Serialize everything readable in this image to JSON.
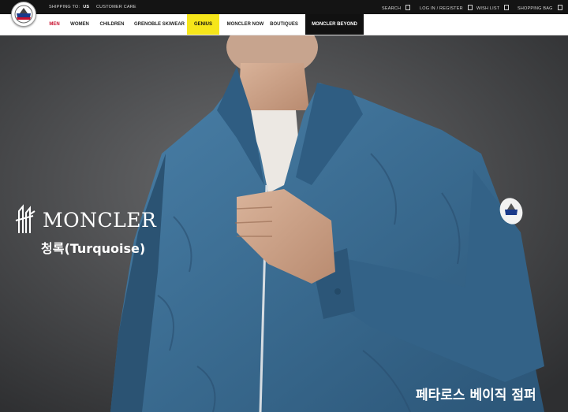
{
  "topbar": {
    "shipping_label": "SHIPPING TO:",
    "shipping_value": "US",
    "customer_care": "CUSTOMER CARE",
    "search": "SEARCH",
    "login": "LOG IN / REGISTER",
    "wishlist": "WISH LIST",
    "bag": "SHOPPING BAG"
  },
  "nav": {
    "items": [
      "MEN",
      "WOMEN",
      "CHILDREN",
      "GRENOBLE SKIWEAR",
      "GENIUS",
      "MONCLER NOW",
      "BOUTIQUES",
      "MONCLER BEYOND"
    ]
  },
  "overlay": {
    "brand": "MONCLER",
    "color_label": "청록(Turquoise)",
    "product_name": "페타로스 베이직 점퍼"
  },
  "colors": {
    "active_nav": "#c8102e",
    "genius_bg": "#f6e61a",
    "beyond_bg": "#111111",
    "jacket": "#3b6f95"
  },
  "icons": [
    "moncler-logo-icon",
    "search-icon",
    "user-icon",
    "heart-icon",
    "bag-icon",
    "moncler-rooster-icon",
    "sleeve-patch-icon"
  ]
}
